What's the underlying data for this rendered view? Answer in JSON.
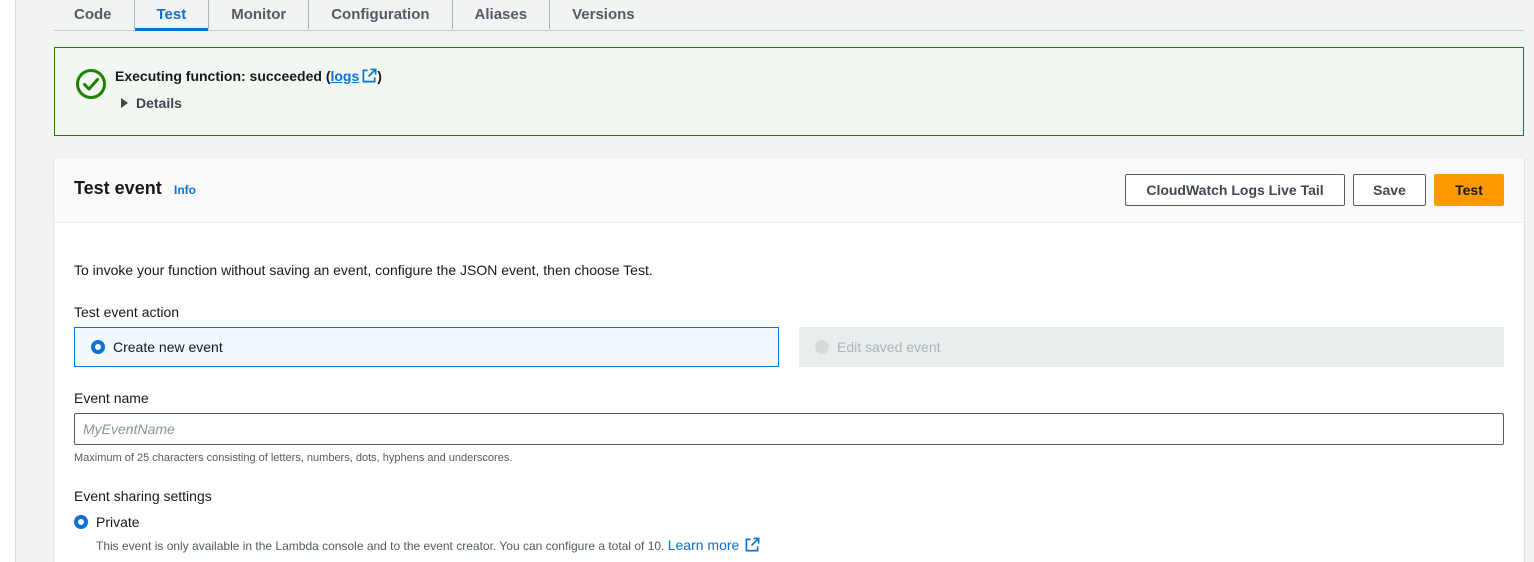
{
  "tabs": [
    {
      "label": "Code",
      "active": false
    },
    {
      "label": "Test",
      "active": true
    },
    {
      "label": "Monitor",
      "active": false
    },
    {
      "label": "Configuration",
      "active": false
    },
    {
      "label": "Aliases",
      "active": false
    },
    {
      "label": "Versions",
      "active": false
    }
  ],
  "flash": {
    "title_prefix": "Executing function: succeeded (",
    "logs_link": "logs",
    "title_suffix": ")",
    "details_label": "Details",
    "status_color": "#1d8102"
  },
  "test_event": {
    "title": "Test event",
    "info_link": "Info",
    "buttons": {
      "live_tail": "CloudWatch Logs Live Tail",
      "save": "Save",
      "test": "Test"
    },
    "description": "To invoke your function without saving an event, configure the JSON event, then choose Test.",
    "action_label": "Test event action",
    "action_options": {
      "create_new": "Create new event",
      "edit_saved": "Edit saved event"
    },
    "event_name_label": "Event name",
    "event_name_placeholder": "MyEventName",
    "event_name_value": "",
    "event_name_hint": "Maximum of 25 characters consisting of letters, numbers, dots, hyphens and underscores.",
    "sharing_label": "Event sharing settings",
    "sharing_private": "Private",
    "sharing_private_desc": "This event is only available in the Lambda console and to the event creator. You can configure a total of 10.",
    "learn_more": "Learn more"
  },
  "colors": {
    "accent": "#0972d3",
    "primary_button": "#ff9900",
    "success": "#1d8102"
  },
  "icons": {
    "status": "check-circle-icon",
    "external": "external-link-icon",
    "details": "caret-right-icon"
  }
}
